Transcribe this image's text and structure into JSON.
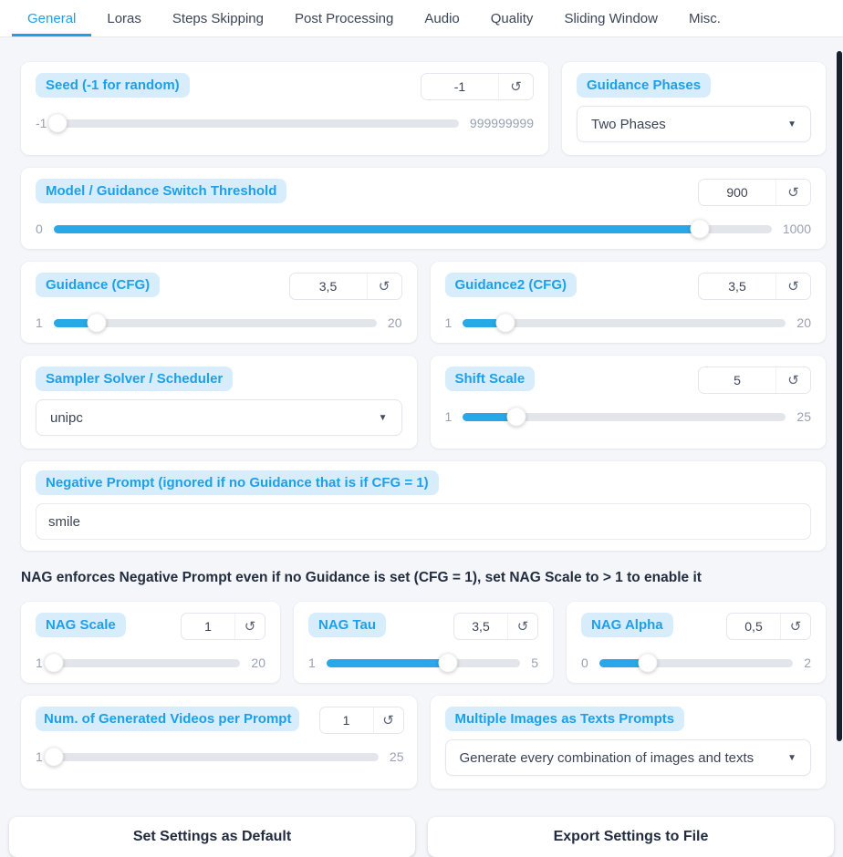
{
  "tabs": [
    "General",
    "Loras",
    "Steps Skipping",
    "Post Processing",
    "Audio",
    "Quality",
    "Sliding Window",
    "Misc."
  ],
  "active_tab": "General",
  "icons": {
    "reset": "↺",
    "caret": "▼"
  },
  "colors": {
    "accent": "#1da0e8",
    "pill_bg": "#d7edfb",
    "slider_fill": "#28a7e9",
    "page_bg": "#f4f6fa",
    "text_dark": "#232d3e"
  },
  "seed": {
    "label": "Seed (-1 for random)",
    "value": "-1",
    "min": "-1",
    "max": "999999999",
    "pct": 0
  },
  "guidance_phases": {
    "label": "Guidance Phases",
    "value": "Two Phases"
  },
  "switch_threshold": {
    "label": "Model / Guidance Switch Threshold",
    "value": "900",
    "min": "0",
    "max": "1000",
    "pct": 90
  },
  "guidance": {
    "label": "Guidance (CFG)",
    "value": "3,5",
    "min": "1",
    "max": "20",
    "pct": 13.2
  },
  "guidance2": {
    "label": "Guidance2 (CFG)",
    "value": "3,5",
    "min": "1",
    "max": "20",
    "pct": 13.2
  },
  "sampler": {
    "label": "Sampler Solver / Scheduler",
    "value": "unipc"
  },
  "shift_scale": {
    "label": "Shift Scale",
    "value": "5",
    "min": "1",
    "max": "25",
    "pct": 16.7
  },
  "negative_prompt": {
    "label": "Negative Prompt (ignored if no Guidance that is if CFG = 1)",
    "value": "smile"
  },
  "nag_note": "NAG enforces Negative Prompt even if no Guidance is set (CFG = 1), set NAG Scale to > 1 to enable it",
  "nag_scale": {
    "label": "NAG Scale",
    "value": "1",
    "min": "1",
    "max": "20",
    "pct": 0
  },
  "nag_tau": {
    "label": "NAG Tau",
    "value": "3,5",
    "min": "1",
    "max": "5",
    "pct": 62.5
  },
  "nag_alpha": {
    "label": "NAG Alpha",
    "value": "0,5",
    "min": "0",
    "max": "2",
    "pct": 25
  },
  "num_videos": {
    "label": "Num. of Generated Videos per Prompt",
    "value": "1",
    "min": "1",
    "max": "25",
    "pct": 0
  },
  "multi_images": {
    "label": "Multiple Images as Texts Prompts",
    "value": "Generate every combination of images and texts"
  },
  "buttons": {
    "set_default": "Set Settings as Default",
    "export": "Export Settings to File"
  }
}
